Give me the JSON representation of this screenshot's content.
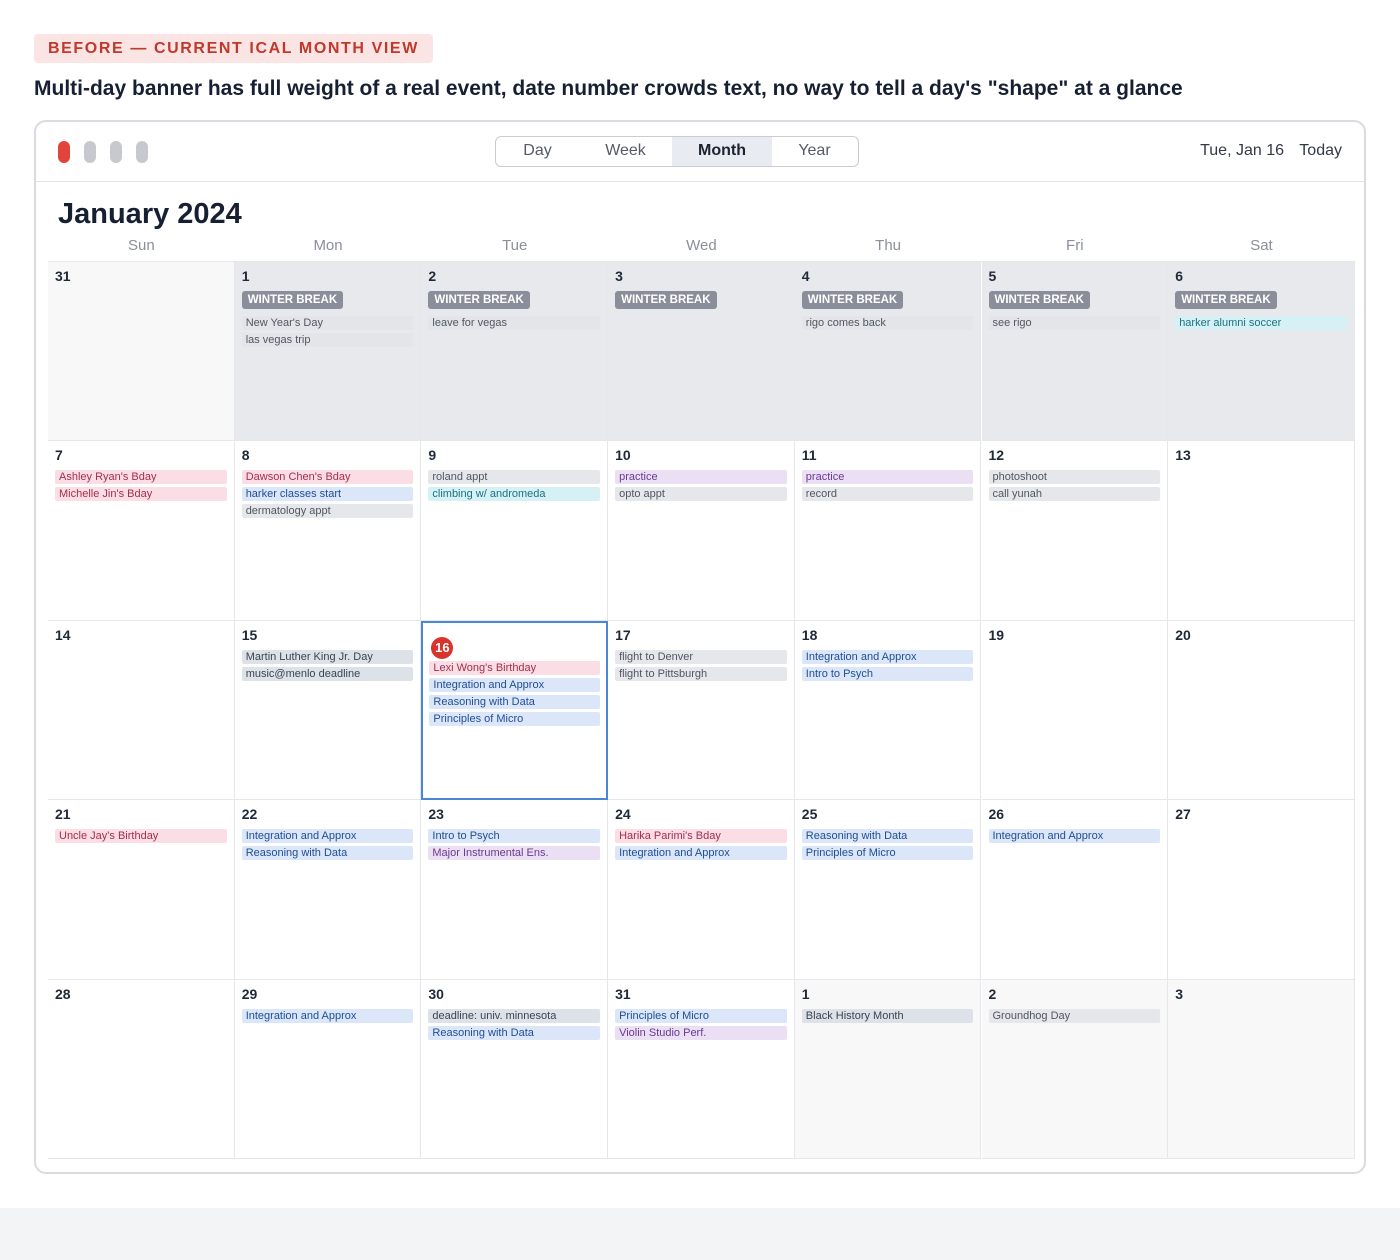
{
  "label": "BEFORE — CURRENT ICAL MONTH VIEW",
  "headline": "Multi-day banner has full weight of a real event, date number crowds text, no way to tell a day's \"shape\" at a glance",
  "toolbar": {
    "views": [
      "Day",
      "Week",
      "Month",
      "Year"
    ],
    "active_view": "Month",
    "date_label": "Tue, Jan 16",
    "today_label": "Today"
  },
  "month_title": "January 2024",
  "weekdays": [
    "Sun",
    "Mon",
    "Tue",
    "Wed",
    "Thu",
    "Fri",
    "Sat"
  ],
  "colors": {
    "accent_red": "#d8342b",
    "today_border": "#4a88d6",
    "banner_gray": "#8a8e9a"
  },
  "weeks": [
    [
      {
        "day": "31",
        "state": "faded",
        "events": []
      },
      {
        "day": "1",
        "state": "shaded",
        "events": [
          {
            "text": "WINTER BREAK",
            "kind": "banner"
          },
          {
            "text": "New Year's Day",
            "color": "muted"
          },
          {
            "text": "las vegas trip",
            "color": "muted"
          }
        ]
      },
      {
        "day": "2",
        "state": "shaded",
        "events": [
          {
            "text": "WINTER BREAK",
            "kind": "banner"
          },
          {
            "text": "leave for vegas",
            "color": "muted"
          }
        ]
      },
      {
        "day": "3",
        "state": "shaded",
        "events": [
          {
            "text": "WINTER BREAK",
            "kind": "banner"
          }
        ]
      },
      {
        "day": "4",
        "state": "shaded",
        "events": [
          {
            "text": "WINTER BREAK",
            "kind": "banner"
          },
          {
            "text": "rigo comes back",
            "color": "muted"
          }
        ]
      },
      {
        "day": "5",
        "state": "shaded",
        "events": [
          {
            "text": "WINTER BREAK",
            "kind": "banner"
          },
          {
            "text": "see rigo",
            "color": "muted"
          }
        ]
      },
      {
        "day": "6",
        "state": "shaded",
        "events": [
          {
            "text": "WINTER BREAK",
            "kind": "banner"
          },
          {
            "text": "harker alumni soccer",
            "color": "teal"
          }
        ]
      }
    ],
    [
      {
        "day": "7",
        "events": [
          {
            "text": "Ashley Ryan's Bday",
            "color": "pink"
          },
          {
            "text": "Michelle Jin's Bday",
            "color": "pink"
          }
        ]
      },
      {
        "day": "8",
        "events": [
          {
            "text": "Dawson Chen's Bday",
            "color": "pink"
          },
          {
            "text": "harker classes start",
            "color": "blue"
          },
          {
            "text": "dermatology appt",
            "color": "gray"
          }
        ]
      },
      {
        "day": "9",
        "events": [
          {
            "text": "roland appt",
            "color": "gray"
          },
          {
            "text": "climbing w/ andromeda",
            "color": "teal"
          }
        ]
      },
      {
        "day": "10",
        "events": [
          {
            "text": "practice",
            "color": "purple"
          },
          {
            "text": "opto appt",
            "color": "gray"
          }
        ]
      },
      {
        "day": "11",
        "events": [
          {
            "text": "practice",
            "color": "purple"
          },
          {
            "text": "record",
            "color": "gray"
          }
        ]
      },
      {
        "day": "12",
        "events": [
          {
            "text": "photoshoot",
            "color": "gray"
          },
          {
            "text": "call yunah",
            "color": "gray"
          }
        ]
      },
      {
        "day": "13",
        "events": []
      }
    ],
    [
      {
        "day": "14",
        "events": []
      },
      {
        "day": "15",
        "events": [
          {
            "text": "Martin Luther King Jr. Day",
            "color": "slate"
          },
          {
            "text": "music@menlo deadline",
            "color": "slate"
          }
        ]
      },
      {
        "day": "16",
        "state": "today",
        "events": [
          {
            "text": "Lexi Wong's Birthday",
            "color": "pink"
          },
          {
            "text": "Integration and Approx",
            "color": "blue"
          },
          {
            "text": "Reasoning with Data",
            "color": "blue"
          },
          {
            "text": "Principles of Micro",
            "color": "blue"
          }
        ]
      },
      {
        "day": "17",
        "events": [
          {
            "text": "flight to Denver",
            "color": "gray"
          },
          {
            "text": "flight to Pittsburgh",
            "color": "gray"
          }
        ]
      },
      {
        "day": "18",
        "events": [
          {
            "text": "Integration and Approx",
            "color": "blue"
          },
          {
            "text": "Intro to Psych",
            "color": "blue"
          }
        ]
      },
      {
        "day": "19",
        "events": []
      },
      {
        "day": "20",
        "events": []
      }
    ],
    [
      {
        "day": "21",
        "events": [
          {
            "text": "Uncle Jay's Birthday",
            "color": "pink"
          }
        ]
      },
      {
        "day": "22",
        "events": [
          {
            "text": "Integration and Approx",
            "color": "blue"
          },
          {
            "text": "Reasoning with Data",
            "color": "blue"
          }
        ]
      },
      {
        "day": "23",
        "events": [
          {
            "text": "Intro to Psych",
            "color": "blue"
          },
          {
            "text": "Major Instrumental Ens.",
            "color": "purple"
          }
        ]
      },
      {
        "day": "24",
        "events": [
          {
            "text": "Harika Parimi's Bday",
            "color": "pink"
          },
          {
            "text": "Integration and Approx",
            "color": "blue"
          }
        ]
      },
      {
        "day": "25",
        "events": [
          {
            "text": "Reasoning with Data",
            "color": "blue"
          },
          {
            "text": "Principles of Micro",
            "color": "blue"
          }
        ]
      },
      {
        "day": "26",
        "events": [
          {
            "text": "Integration and Approx",
            "color": "blue"
          }
        ]
      },
      {
        "day": "27",
        "events": []
      }
    ],
    [
      {
        "day": "28",
        "events": []
      },
      {
        "day": "29",
        "events": [
          {
            "text": "Integration and Approx",
            "color": "blue"
          }
        ]
      },
      {
        "day": "30",
        "events": [
          {
            "text": "deadline: univ. minnesota",
            "color": "slate"
          },
          {
            "text": "Reasoning with Data",
            "color": "blue"
          }
        ]
      },
      {
        "day": "31",
        "events": [
          {
            "text": "Principles of Micro",
            "color": "blue"
          },
          {
            "text": "Violin Studio Perf.",
            "color": "purple"
          }
        ]
      },
      {
        "day": "1",
        "state": "faded",
        "events": [
          {
            "text": "Black History Month",
            "color": "slate"
          }
        ]
      },
      {
        "day": "2",
        "state": "faded",
        "events": [
          {
            "text": "Groundhog Day",
            "color": "gray"
          }
        ]
      },
      {
        "day": "3",
        "state": "faded",
        "events": []
      }
    ]
  ]
}
